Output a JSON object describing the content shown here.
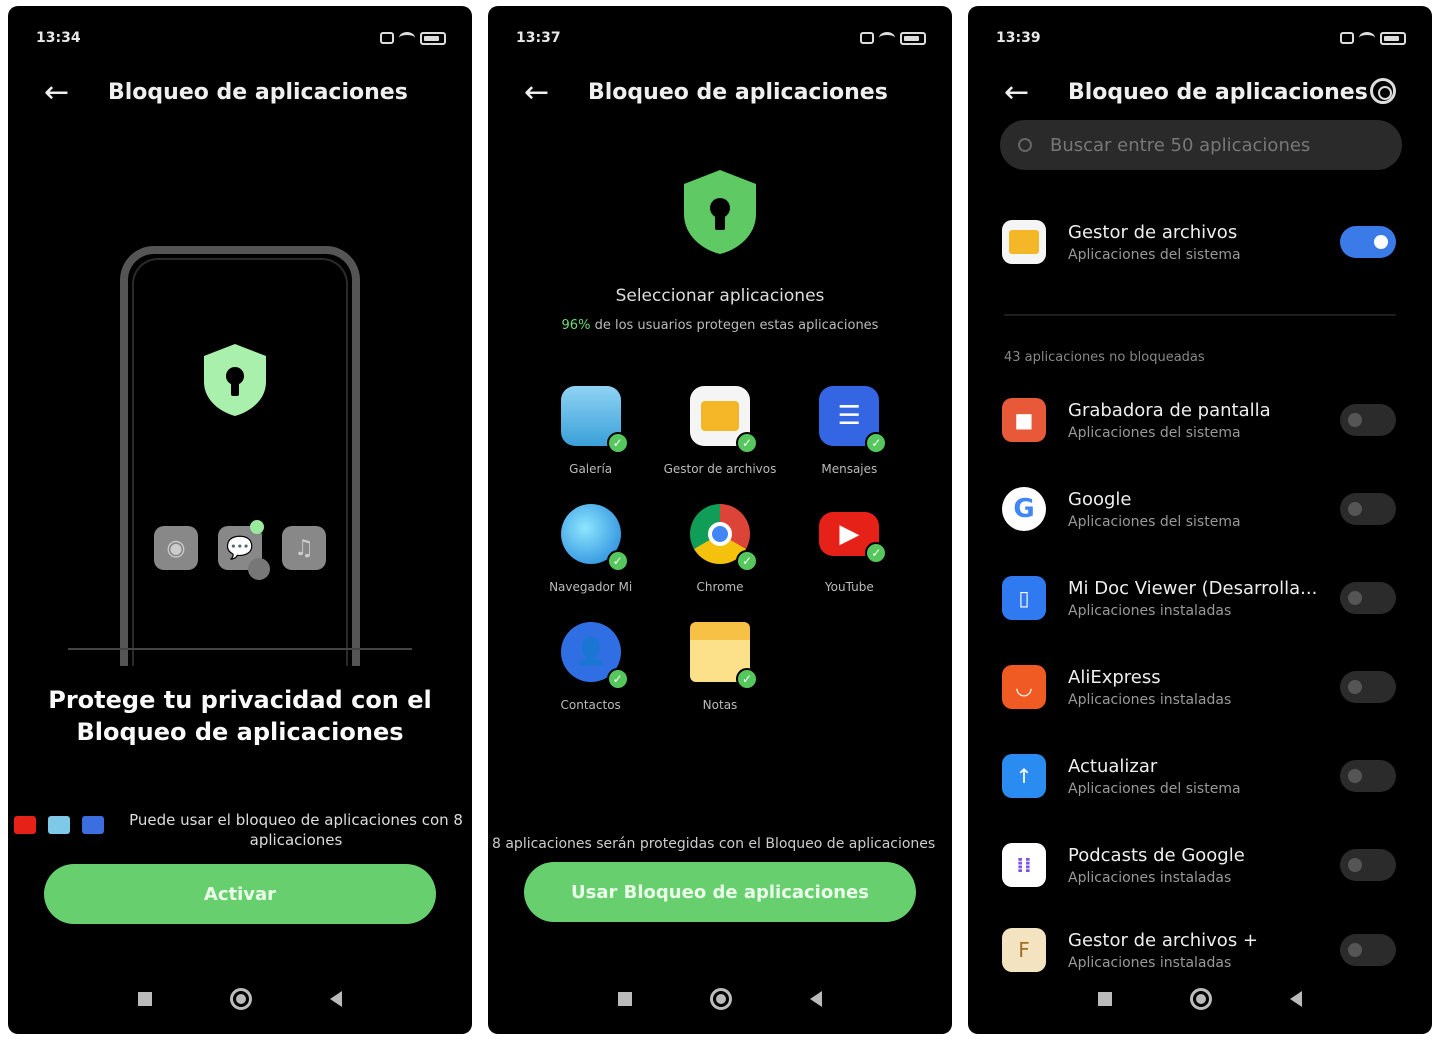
{
  "screen1": {
    "time": "13:34",
    "title": "Bloqueo de aplicaciones",
    "headline": "Protege tu privacidad con el Bloqueo de aplicaciones",
    "info": "Puede usar el bloqueo de aplicaciones con 8 aplicaciones",
    "button": "Activar"
  },
  "screen2": {
    "time": "13:37",
    "title": "Bloqueo de aplicaciones",
    "heading": "Seleccionar aplicaciones",
    "sub_pct": "96%",
    "sub_text": " de los usuarios protegen estas aplicaciones",
    "apps": [
      {
        "label": "Galería"
      },
      {
        "label": "Gestor de archivos"
      },
      {
        "label": "Mensajes"
      },
      {
        "label": "Navegador Mi"
      },
      {
        "label": "Chrome"
      },
      {
        "label": "YouTube"
      },
      {
        "label": "Contactos"
      },
      {
        "label": "Notas"
      }
    ],
    "note": "8 aplicaciones serán protegidas con el Bloqueo de aplicaciones",
    "button": "Usar Bloqueo de aplicaciones"
  },
  "screen3": {
    "time": "13:39",
    "title": "Bloqueo de aplicaciones",
    "search_placeholder": "Buscar entre 50 aplicaciones",
    "locked_app": {
      "name": "Gestor de archivos",
      "category": "Aplicaciones del sistema",
      "enabled": true
    },
    "section_label": "43 aplicaciones no bloqueadas",
    "apps": [
      {
        "name": "Grabadora de pantalla",
        "category": "Aplicaciones del sistema",
        "enabled": false
      },
      {
        "name": "Google",
        "category": "Aplicaciones del sistema",
        "enabled": false
      },
      {
        "name": "Mi Doc Viewer (Desarrolla...",
        "category": "Aplicaciones instaladas",
        "enabled": false
      },
      {
        "name": "AliExpress",
        "category": "Aplicaciones instaladas",
        "enabled": false
      },
      {
        "name": "Actualizar",
        "category": "Aplicaciones del sistema",
        "enabled": false
      },
      {
        "name": "Podcasts de Google",
        "category": "Aplicaciones instaladas",
        "enabled": false
      },
      {
        "name": "Gestor de archivos +",
        "category": "Aplicaciones instaladas",
        "enabled": false
      }
    ]
  },
  "colors": {
    "accent_green": "#68cf6e",
    "toggle_blue": "#3a7be8",
    "background": "#000000"
  }
}
